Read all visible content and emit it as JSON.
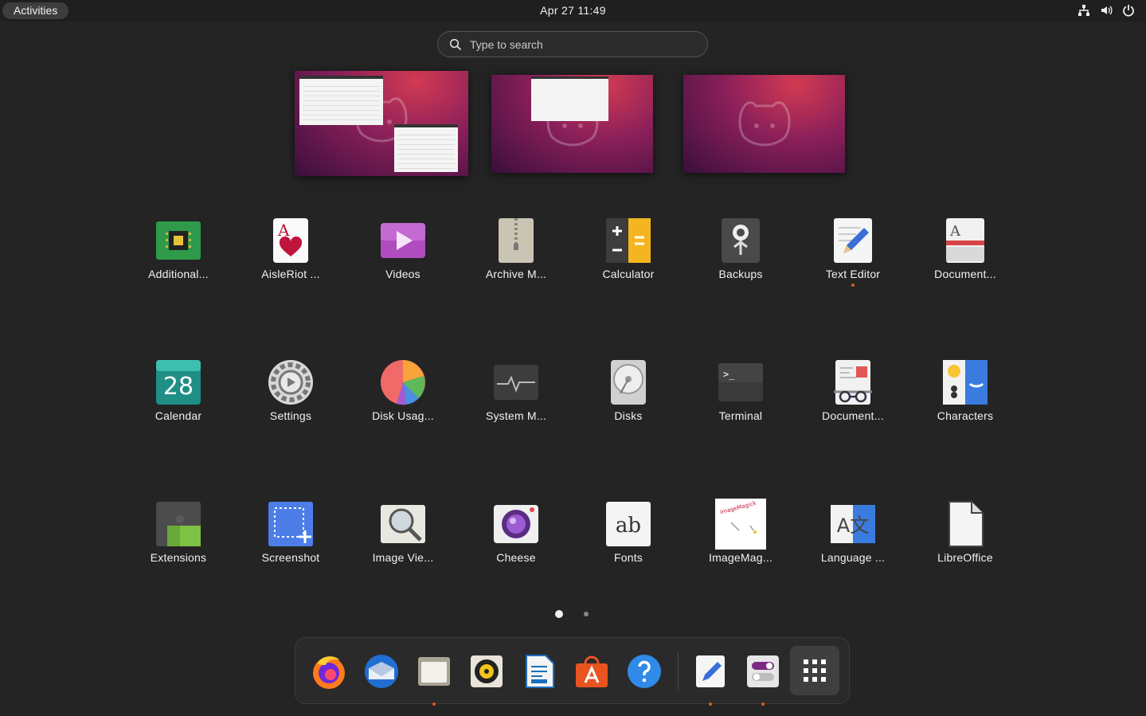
{
  "topbar": {
    "activities_label": "Activities",
    "clock": "Apr 27  11:49",
    "tray_icons": [
      "network-icon",
      "volume-icon",
      "power-icon"
    ]
  },
  "search": {
    "placeholder": "Type to search"
  },
  "workspaces": [
    "Workspace 1",
    "Workspace 2",
    "Workspace 3"
  ],
  "apps": [
    {
      "label": "Additional...",
      "icon": "chip-icon"
    },
    {
      "label": "AisleRiot ...",
      "icon": "card-icon"
    },
    {
      "label": "Videos",
      "icon": "video-icon"
    },
    {
      "label": "Archive M...",
      "icon": "archive-icon"
    },
    {
      "label": "Calculator",
      "icon": "calculator-icon"
    },
    {
      "label": "Backups",
      "icon": "safe-icon"
    },
    {
      "label": "Text Editor",
      "icon": "text-editor-icon",
      "running": true
    },
    {
      "label": "Document...",
      "icon": "document-viewer-icon"
    },
    {
      "label": "Calendar",
      "icon": "calendar-icon",
      "day": "28"
    },
    {
      "label": "Settings",
      "icon": "gear-icon"
    },
    {
      "label": "Disk Usag...",
      "icon": "pie-icon"
    },
    {
      "label": "System M...",
      "icon": "monitor-icon"
    },
    {
      "label": "Disks",
      "icon": "disk-icon"
    },
    {
      "label": "Terminal",
      "icon": "terminal-icon",
      "prompt": ">_"
    },
    {
      "label": "Document...",
      "icon": "document-scanner-icon"
    },
    {
      "label": "Characters",
      "icon": "characters-icon"
    },
    {
      "label": "Extensions",
      "icon": "puzzle-icon"
    },
    {
      "label": "Screenshot",
      "icon": "screenshot-icon"
    },
    {
      "label": "Image Vie...",
      "icon": "magnifier-icon"
    },
    {
      "label": "Cheese",
      "icon": "camera-icon"
    },
    {
      "label": "Fonts",
      "icon": "fonts-icon",
      "glyphs": "ab"
    },
    {
      "label": "ImageMag...",
      "icon": "imagemagick-icon",
      "logo_text": "ImageMagick"
    },
    {
      "label": "Language ...",
      "icon": "language-icon",
      "glyphs": "A文"
    },
    {
      "label": "LibreOffice",
      "icon": "libreoffice-icon"
    }
  ],
  "pager": {
    "pages": 2,
    "current": 1
  },
  "dock": [
    {
      "name": "firefox-icon",
      "running": false
    },
    {
      "name": "thunderbird-icon",
      "running": false
    },
    {
      "name": "files-icon",
      "running": true
    },
    {
      "name": "rhythmbox-icon",
      "running": false
    },
    {
      "name": "writer-icon",
      "running": false
    },
    {
      "name": "app-center-icon",
      "running": false
    },
    {
      "name": "help-icon",
      "running": false
    },
    {
      "name": "text-editor-icon",
      "running": true
    },
    {
      "name": "tweaks-icon",
      "running": true
    },
    {
      "name": "show-apps-icon",
      "running": false
    }
  ],
  "colors": {
    "accent": "#e95420",
    "background": "#242424"
  }
}
